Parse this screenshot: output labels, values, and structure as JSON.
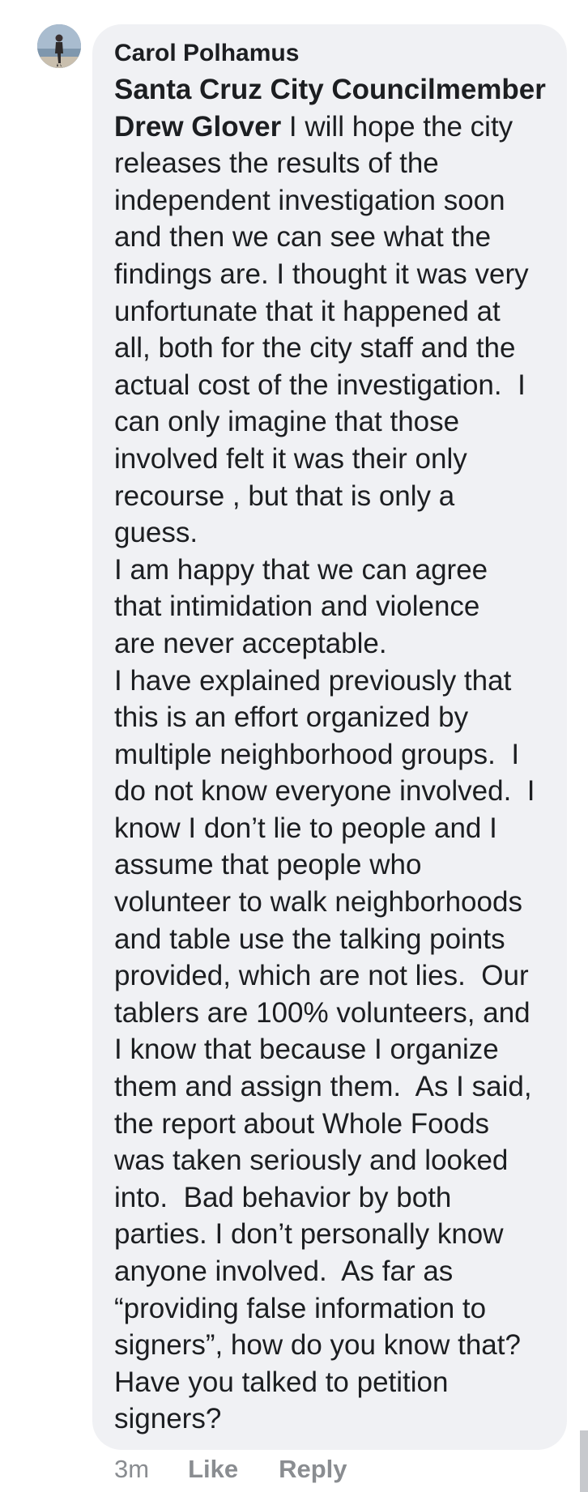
{
  "comment": {
    "author": "Carol Polhamus",
    "mention": "Santa Cruz City Councilmember Drew Glover",
    "lines": [
      {
        "tag": "Santa Cruz City Councilmember",
        "text": ""
      },
      {
        "tag": "Drew Glover",
        "text": " I will hope the city"
      },
      {
        "tag": "",
        "text": "releases the results of the"
      },
      {
        "tag": "",
        "text": "independent investigation soon"
      },
      {
        "tag": "",
        "text": "and then we can see what the"
      },
      {
        "tag": "",
        "text": "findings are. I thought it was very"
      },
      {
        "tag": "",
        "text": "unfortunate that it happened at"
      },
      {
        "tag": "",
        "text": "all, both for the city staff and the"
      },
      {
        "tag": "",
        "text": "actual cost of the investigation.  I"
      },
      {
        "tag": "",
        "text": "can only imagine that those"
      },
      {
        "tag": "",
        "text": "involved felt it was their only"
      },
      {
        "tag": "",
        "text": "recourse , but that is only a"
      },
      {
        "tag": "",
        "text": "guess."
      },
      {
        "tag": "",
        "text": "I am happy that we can agree"
      },
      {
        "tag": "",
        "text": "that intimidation and violence"
      },
      {
        "tag": "",
        "text": "are never acceptable."
      },
      {
        "tag": "",
        "text": "I have explained previously that"
      },
      {
        "tag": "",
        "text": "this is an effort organized by"
      },
      {
        "tag": "",
        "text": "multiple neighborhood groups.  I"
      },
      {
        "tag": "",
        "text": "do not know everyone involved.  I"
      },
      {
        "tag": "",
        "text": "know I don’t lie to people and I"
      },
      {
        "tag": "",
        "text": "assume that people who"
      },
      {
        "tag": "",
        "text": "volunteer to walk neighborhoods"
      },
      {
        "tag": "",
        "text": "and table use the talking points"
      },
      {
        "tag": "",
        "text": "provided, which are not lies.  Our"
      },
      {
        "tag": "",
        "text": "tablers are 100% volunteers, and"
      },
      {
        "tag": "",
        "text": "I know that because I organize"
      },
      {
        "tag": "",
        "text": "them and assign them.  As I said,"
      },
      {
        "tag": "",
        "text": "the report about Whole Foods"
      },
      {
        "tag": "",
        "text": "was taken seriously and looked"
      },
      {
        "tag": "",
        "text": "into.  Bad behavior by both"
      },
      {
        "tag": "",
        "text": "parties. I don’t personally know"
      },
      {
        "tag": "",
        "text": "anyone involved.  As far as"
      },
      {
        "tag": "",
        "text": "“providing false information to"
      },
      {
        "tag": "",
        "text": "signers”, how do you know that?"
      },
      {
        "tag": "",
        "text": "Have you talked to petition"
      },
      {
        "tag": "",
        "text": "signers?"
      }
    ]
  },
  "actions": {
    "timestamp": "3m",
    "like_label": "Like",
    "reply_label": "Reply"
  },
  "colors": {
    "bubble": "#f0f1f4",
    "text": "#1c1e21",
    "meta": "#8a8d91"
  }
}
